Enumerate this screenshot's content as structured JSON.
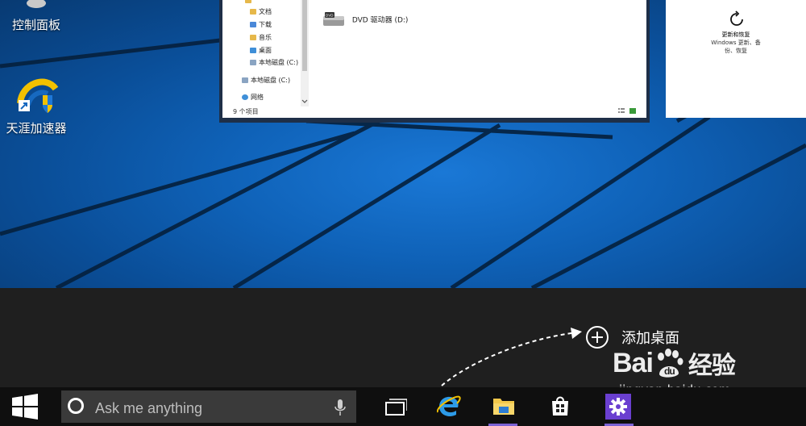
{
  "desktop": {
    "icons": [
      {
        "label": "控制面板",
        "icon": "control-panel-icon"
      },
      {
        "label": "天涯加速器",
        "icon": "accelerator-icon"
      }
    ]
  },
  "explorer": {
    "nav_items": [
      {
        "label": "文档",
        "icon": "folder-icon"
      },
      {
        "label": "下载",
        "icon": "download-icon"
      },
      {
        "label": "音乐",
        "icon": "music-icon"
      },
      {
        "label": "桌面",
        "icon": "desktop-folder-icon"
      },
      {
        "label": "本地磁盘 (C:)",
        "icon": "disk-icon"
      },
      {
        "label": "本地磁盘 (C:)",
        "icon": "disk-icon"
      },
      {
        "label": "网络",
        "icon": "network-icon"
      }
    ],
    "drive_label": "DVD 驱动器 (D:)",
    "status": "9 个项目"
  },
  "settings_tile": {
    "line1": "更新和恢复",
    "line2": "Windows 更新、备",
    "line3": "份、恢复"
  },
  "task_view": {
    "add_desktop_label": "添加桌面"
  },
  "watermark": {
    "brand": "Bai",
    "brand_cn": "经验",
    "url": "jingyan.baidu.com"
  },
  "taskbar": {
    "search_placeholder": "Ask me anything",
    "pinned": [
      "task-view-icon",
      "edge-e-icon",
      "file-explorer-icon",
      "store-icon",
      "settings-gear-icon"
    ],
    "accent": "#7b62d4"
  }
}
